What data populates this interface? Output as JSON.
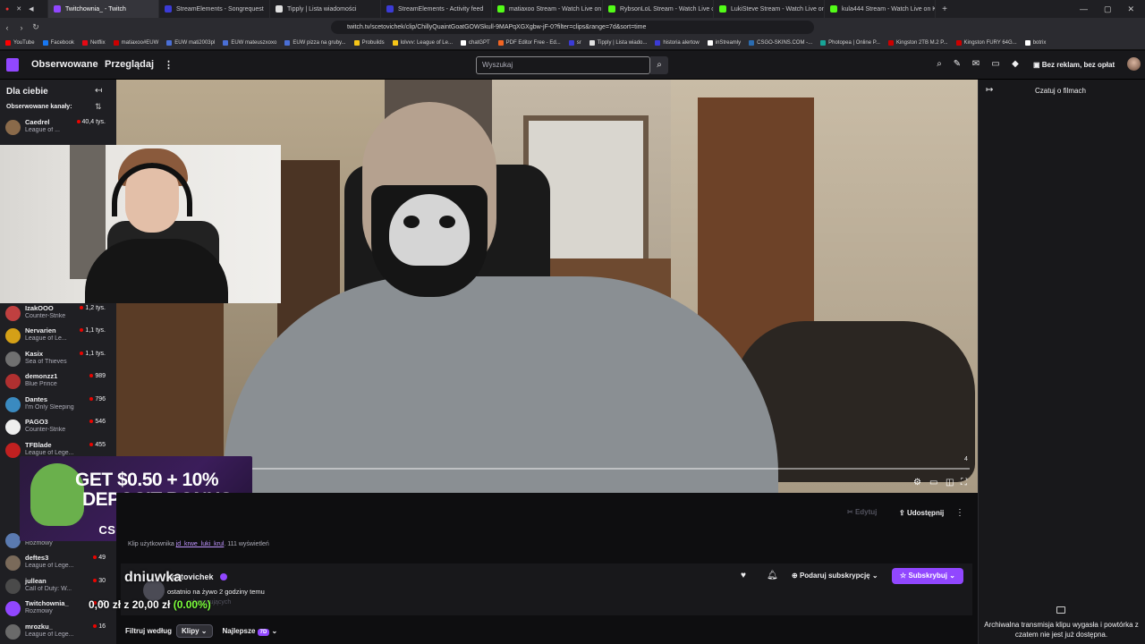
{
  "browser": {
    "tabs": [
      {
        "label": "Twitchownia_ - Twitch",
        "color": "#9147ff",
        "active": true
      },
      {
        "label": "StreamElements - Songrequest",
        "color": "#3b3bd6"
      },
      {
        "label": "Tipply | Lista wiadomości",
        "color": "#e0e0e0"
      },
      {
        "label": "StreamElements - Activity feed",
        "color": "#3b3bd6"
      },
      {
        "label": "matiaxoo Stream - Watch Live on Ki",
        "color": "#53fc18"
      },
      {
        "label": "RybsonLoL Stream - Watch Live on K",
        "color": "#53fc18"
      },
      {
        "label": "LukiSteve Stream - Watch Live on Kic",
        "color": "#53fc18"
      },
      {
        "label": "kula444 Stream - Watch Live on Kick",
        "color": "#53fc18"
      }
    ],
    "new_tab": "+",
    "window_controls": [
      "—",
      "▢",
      "✕"
    ],
    "url": "twitch.tv/scetovichek/clip/ChillyQuaintGoatGOWSkull-9MAPqXGXgbw-jF-0?filter=clips&range=7d&sort=time",
    "bookmarks": [
      {
        "label": "YouTube",
        "color": "#ff0000"
      },
      {
        "label": "Facebook",
        "color": "#1877f2"
      },
      {
        "label": "Netflix",
        "color": "#e50914"
      },
      {
        "label": "matiaxoo#EUW",
        "color": "#c00"
      },
      {
        "label": "EUW mati2003pl",
        "color": "#4a6fd6"
      },
      {
        "label": "EUW mateuszxoxo",
        "color": "#4a6fd6"
      },
      {
        "label": "EUW pizza na gruby...",
        "color": "#4a6fd6"
      },
      {
        "label": "Probuilds",
        "color": "#f5c518"
      },
      {
        "label": "lolvvv: League of Le...",
        "color": "#f5c518"
      },
      {
        "label": "chatGPT",
        "color": "#ffffff"
      },
      {
        "label": "PDF Editor Free - Ed...",
        "color": "#f26522"
      },
      {
        "label": "sr",
        "color": "#3b3bd6"
      },
      {
        "label": "Tipply | Lista wiado...",
        "color": "#e0e0e0"
      },
      {
        "label": "historia alertow",
        "color": "#3b3bd6"
      },
      {
        "label": "inStreamly",
        "color": "#ffffff"
      },
      {
        "label": "CSGO-SKINS.COM -...",
        "color": "#2b6cb0"
      },
      {
        "label": "Photopea | Online P...",
        "color": "#18a497"
      },
      {
        "label": "Kingston 2TB M.2 P...",
        "color": "#cc0000"
      },
      {
        "label": "Kingston FURY 64G...",
        "color": "#cc0000"
      },
      {
        "label": "botrix",
        "color": "#ffffff"
      }
    ]
  },
  "topnav": {
    "following": "Obserwowane",
    "browse": "Przeglądaj",
    "search_placeholder": "Wyszukaj",
    "ad_free": "Bez reklam, bez opłat"
  },
  "sidebar": {
    "title": "Dla ciebie",
    "followed_label": "Obserwowane kanały:",
    "channels": [
      {
        "name": "Caedrel",
        "game": "League of ...",
        "viewers": "40,4 tys.",
        "color": "#8a6a4a"
      },
      {
        "name": "IzakOOO",
        "game": "Counter-Strike",
        "viewers": "1,2 tys.",
        "color": "#c04040"
      },
      {
        "name": "Nervarien",
        "game": "League of Le...",
        "viewers": "1,1 tys.",
        "color": "#d4a017"
      },
      {
        "name": "Kasix",
        "game": "Sea of Thieves",
        "viewers": "1,1 tys.",
        "color": "#707070"
      },
      {
        "name": "demonzz1",
        "game": "Blue Prince",
        "viewers": "989",
        "color": "#b03030"
      },
      {
        "name": "Dantes",
        "game": "I'm Only Sleeping",
        "viewers": "796",
        "color": "#3a8ac0"
      },
      {
        "name": "PAGO3",
        "game": "Counter-Strike",
        "viewers": "546",
        "color": "#eeeeee"
      },
      {
        "name": "TFBlade",
        "game": "League of Lege...",
        "viewers": "455",
        "color": "#c02020"
      },
      {
        "name": "",
        "game": "Rozmowy",
        "viewers": "",
        "color": "#5a7ab0"
      },
      {
        "name": "deftes3",
        "game": "League of Lege...",
        "viewers": "49",
        "color": "#7a6a5a"
      },
      {
        "name": "jullean",
        "game": "Call of Duty: W...",
        "viewers": "30",
        "color": "#4a4a4a"
      },
      {
        "name": "Twitchownia_",
        "game": "Rozmowy",
        "viewers": "22",
        "color": "#9147ff"
      },
      {
        "name": "mrozku_",
        "game": "League of Lege...",
        "viewers": "16",
        "color": "#6a6a6a"
      }
    ]
  },
  "player": {
    "time_mark": "4"
  },
  "ad": {
    "line1": "GET $0.50 + 10%",
    "line2": "DEPOSIT BONUS",
    "brand": "CSG⊙SKINS"
  },
  "clip": {
    "edit": "Edytuj",
    "share": "Udostępnij",
    "meta_prefix": "Klip użytkownika",
    "meta_user": "jd_krwe_luki_krul",
    "meta_suffix": ". 111 wyświetleń"
  },
  "channel": {
    "overlay_name": "dniuwka",
    "name": "scetovichek",
    "status": "ostatnio na żywo 2 godziny temu",
    "followers": "obserwujących",
    "donation_main": "0,00 zł z 20,00 zł",
    "donation_pct": "(0.00%)",
    "gift_sub": "Podaruj subskrypcję",
    "subscribe": "Subskrybuj"
  },
  "filters": {
    "label": "Filtruj według",
    "type": "Klipy",
    "sort": "Najlepsze",
    "range": "7D"
  },
  "chat": {
    "title": "Czatuj o filmach",
    "message": "Archiwalna transmisja klipu wygasła i powtórka z czatem nie jest już dostępna."
  }
}
